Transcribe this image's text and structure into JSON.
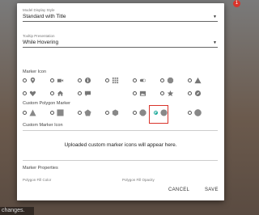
{
  "background": {
    "status_text": "changes.",
    "notification_count": "1"
  },
  "dialog": {
    "model_display_style": {
      "label": "Model Display Style",
      "value": "Standard with Title"
    },
    "tooltip_presentation": {
      "label": "Tooltip Presentation",
      "value": "While Hovering"
    },
    "marker_icon_title": "Marker Icon",
    "custom_polygon_title": "Custom Polygon Marker",
    "custom_marker_icon_title": "Custom Marker Icon",
    "upload_note": "Uploaded custom marker icons will appear here.",
    "marker_properties_title": "Marker Properties",
    "polygon_fill_color_label": "Polygon Fill Color",
    "polygon_fill_opacity_label": "Polygon Fill Opacity",
    "selected_polygon": "circle",
    "accent_color": "#18a999",
    "highlight_color": "#d9342b"
  },
  "marker_icons": {
    "row1": [
      "pin-icon",
      "video-icon",
      "info-icon",
      "grid-icon",
      "toggle-icon",
      "stop-icon",
      "warning-icon"
    ],
    "row2": [
      "heart-icon",
      "home-icon",
      "chat-icon",
      "image-icon",
      "star-icon",
      "compass-icon"
    ]
  },
  "polygons": [
    "triangle",
    "square",
    "pentagon",
    "hexagon",
    "octagon",
    "circle",
    "circle-large"
  ],
  "footer": {
    "cancel_label": "CANCEL",
    "save_label": "SAVE"
  }
}
